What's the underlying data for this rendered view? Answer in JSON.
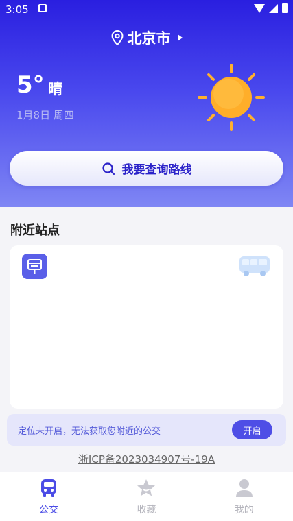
{
  "status_bar": {
    "time": "3:05"
  },
  "location": {
    "city": "北京市"
  },
  "weather": {
    "temperature": "5°",
    "condition": "晴",
    "date": "1月8日 周四"
  },
  "search": {
    "label": "我要查询路线"
  },
  "nearby": {
    "title": "附近站点"
  },
  "location_notice": {
    "text": "定位未开启，无法获取您附近的公交",
    "button": "开启"
  },
  "icp": {
    "text": "浙ICP备2023034907号-19A"
  },
  "tabbar": {
    "items": [
      {
        "label": "公交",
        "icon": "bus-icon",
        "active": true
      },
      {
        "label": "收藏",
        "icon": "star-icon",
        "active": false
      },
      {
        "label": "我的",
        "icon": "user-icon",
        "active": false
      }
    ]
  },
  "colors": {
    "accent": "#4b4ce6",
    "header_top": "#2a1fe0",
    "sun": "#ffb02e"
  }
}
